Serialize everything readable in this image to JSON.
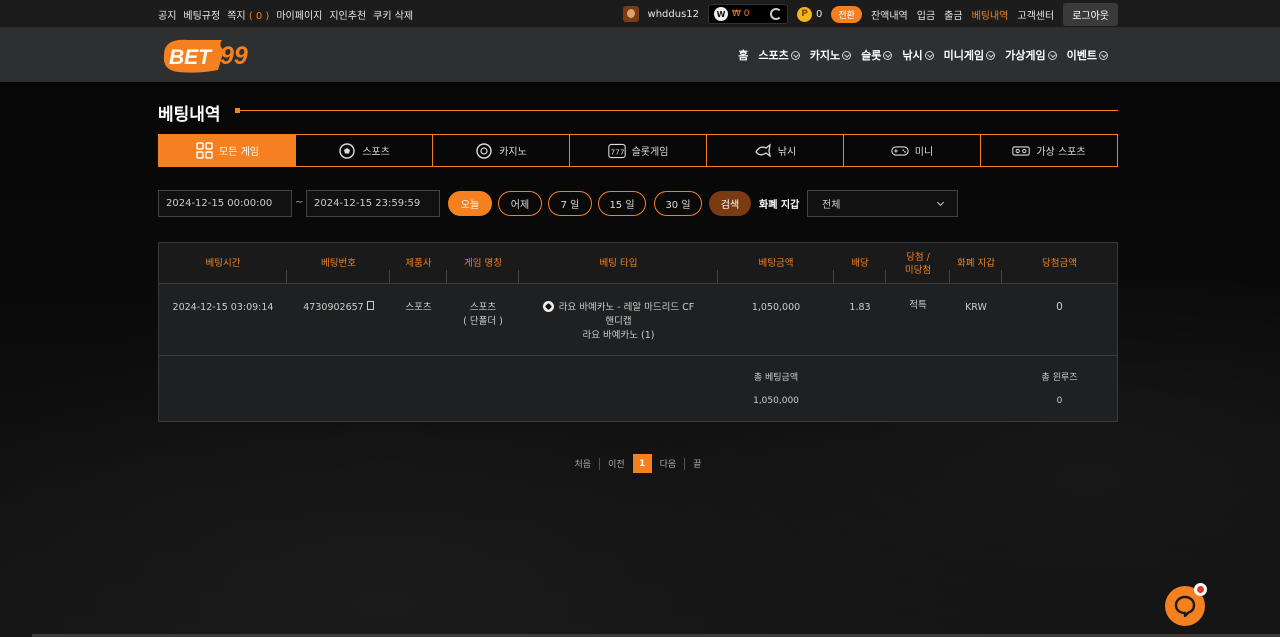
{
  "colors": {
    "accent": "#f5801f",
    "header_bg": "#2d2f30",
    "topbar_bg": "#1c1c1c"
  },
  "topbar": {
    "links": [
      {
        "label": "공지",
        "icon": ""
      },
      {
        "label": "베팅규정"
      },
      {
        "label": "쪽지"
      },
      {
        "label": "마이페이지"
      },
      {
        "label": "지인추천"
      },
      {
        "label": "쿠키 삭제"
      }
    ],
    "message_count": "( 0 )",
    "username": "whddus12",
    "wallet_icon": "W",
    "wallet_amount": "₩ 0",
    "point_icon": "P",
    "point_amount": "0",
    "convert_label": "전환",
    "right_links": [
      "잔액내역",
      "입금",
      "출금",
      "베팅내역",
      "고객센터"
    ],
    "logout_label": "로그아웃"
  },
  "logo": {
    "text": "BET99"
  },
  "nav": {
    "items": [
      "홈",
      "스포츠",
      "카지노",
      "슬롯",
      "낚시",
      "미니게임",
      "가상게임",
      "이벤트"
    ]
  },
  "page": {
    "title": "베팅내역",
    "tabs": [
      {
        "label": "모든 게임",
        "icon": "grid-icon"
      },
      {
        "label": "스포츠",
        "icon": "soccer-ball-icon"
      },
      {
        "label": "카지노",
        "icon": "casino-chip-icon"
      },
      {
        "label": "슬롯게임",
        "icon": "slot-777-icon"
      },
      {
        "label": "낚시",
        "icon": "fish-icon"
      },
      {
        "label": "미니",
        "icon": "gamepad-icon"
      },
      {
        "label": "가상 스포츠",
        "icon": "vr-icon"
      }
    ],
    "filters": {
      "date_from": "2024-12-15 00:00:00",
      "date_sep": "~",
      "date_to": "2024-12-15 23:59:59",
      "quick": [
        "오늘",
        "어제",
        "7 일",
        "15 일",
        "30 일"
      ],
      "search_label": "검색",
      "currency_label": "화폐 지갑",
      "currency_value": "전체"
    },
    "table": {
      "headers": [
        "베팅시간",
        "베팅번호",
        "제품사",
        "게임 명칭",
        "베팅 타입",
        "베팅금액",
        "배당",
        "당첨 /\n미당첨",
        "화폐 지갑",
        "당첨금액"
      ],
      "rows": [
        {
          "time": "2024-12-15 03:09:14",
          "number": "4730902657",
          "provider": "스포츠",
          "game_name": "스포츠",
          "game_sub": "( 단폴더 )",
          "bet_line1": "라요 바예카노 - 레알 마드리드 CF",
          "bet_line2": "핸디캡",
          "bet_line3": "라요 바예카노 (1)",
          "amount": "1,050,000",
          "odds": "1.83",
          "result": "적특",
          "currency": "KRW",
          "win_amount": "0"
        }
      ],
      "total_bet_label": "총 베팅금액",
      "total_bet_value": "1,050,000",
      "total_win_label": "총 윈루즈",
      "total_win_value": "0"
    },
    "pagination": {
      "first": "처음",
      "prev": "이전",
      "current": "1",
      "next": "다음",
      "last": "끝"
    }
  }
}
